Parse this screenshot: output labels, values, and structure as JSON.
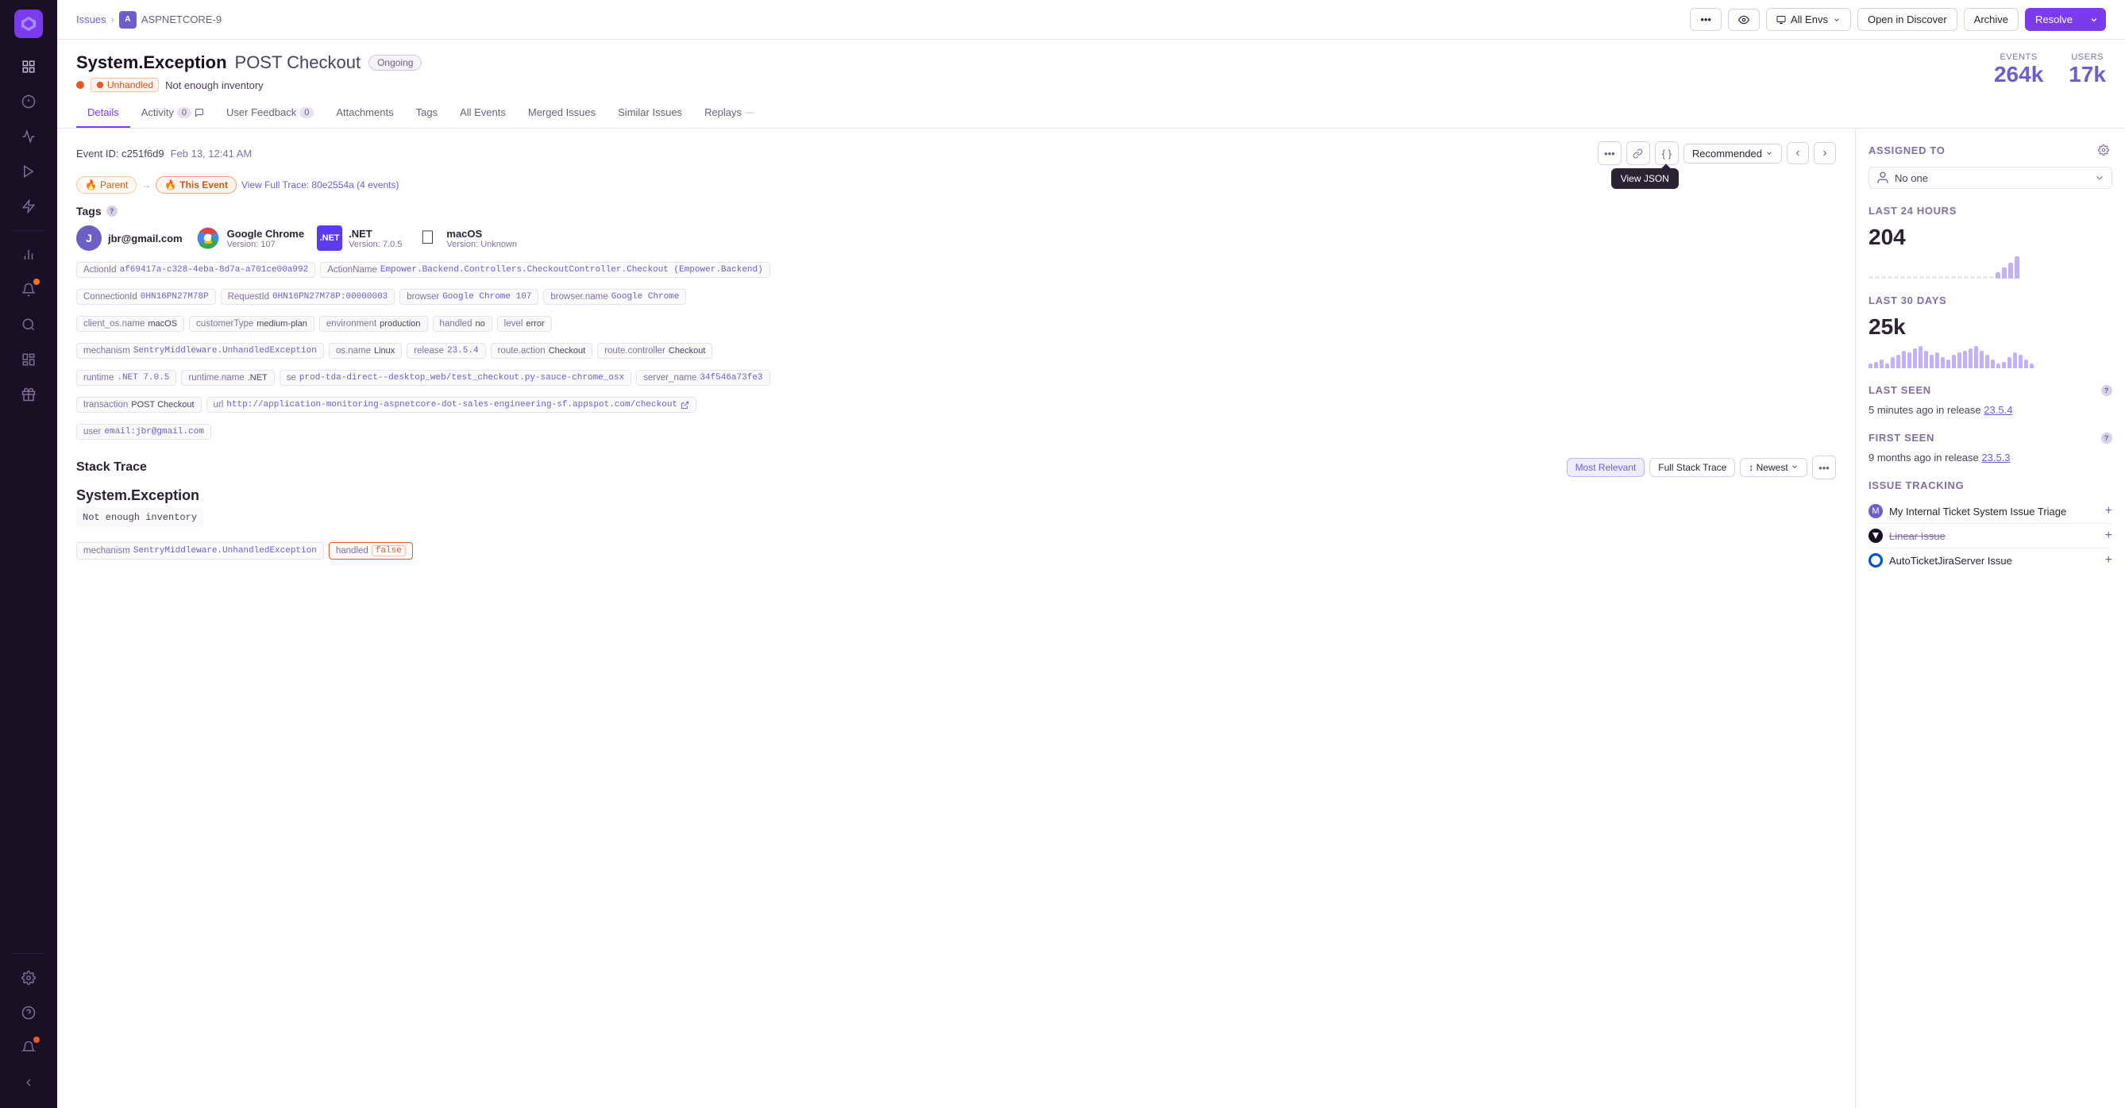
{
  "sidebar": {
    "logo": "◆",
    "items": [
      {
        "name": "issues",
        "icon": "⊡",
        "active": false
      },
      {
        "name": "performance",
        "icon": "▷",
        "active": false
      },
      {
        "name": "replays",
        "icon": "⊙",
        "active": false
      },
      {
        "name": "profiling",
        "icon": "⚡",
        "active": false
      },
      {
        "name": "metrics",
        "icon": "📈",
        "active": false
      },
      {
        "name": "alerts",
        "icon": "🔔",
        "active": false,
        "badge": true
      },
      {
        "name": "discover",
        "icon": "🔭",
        "active": false
      },
      {
        "name": "dashboards",
        "icon": "⊞",
        "active": false
      },
      {
        "name": "releases",
        "icon": "📦",
        "active": false
      },
      {
        "name": "settings",
        "icon": "⚙",
        "active": false
      }
    ],
    "bottom": [
      {
        "name": "help",
        "icon": "?"
      },
      {
        "name": "notifications",
        "icon": "🔔",
        "badge": true
      }
    ]
  },
  "breadcrumb": {
    "issues_label": "Issues",
    "project_label": "ASPNETCORE-9"
  },
  "header": {
    "more_label": "•••",
    "watch_label": "👁",
    "env_label": "All Envs",
    "open_discover_label": "Open in Discover",
    "archive_label": "Archive",
    "resolve_label": "Resolve"
  },
  "issue": {
    "title": "System.Exception",
    "subtitle": "POST Checkout",
    "status": "Ongoing",
    "unhandled_label": "Unhandled",
    "description": "Not enough inventory",
    "events_label": "EVENTS",
    "events_value": "264k",
    "users_label": "USERS",
    "users_value": "17k"
  },
  "tabs": [
    {
      "id": "details",
      "label": "Details",
      "active": true
    },
    {
      "id": "activity",
      "label": "Activity",
      "badge": "0",
      "active": false
    },
    {
      "id": "user_feedback",
      "label": "User Feedback",
      "badge": "0",
      "active": false
    },
    {
      "id": "attachments",
      "label": "Attachments",
      "active": false
    },
    {
      "id": "tags",
      "label": "Tags",
      "active": false
    },
    {
      "id": "all_events",
      "label": "All Events",
      "active": false
    },
    {
      "id": "merged_issues",
      "label": "Merged Issues",
      "active": false
    },
    {
      "id": "similar_issues",
      "label": "Similar Issues",
      "active": false
    },
    {
      "id": "replays",
      "label": "Replays",
      "active": false
    }
  ],
  "event": {
    "id": "c251f6d9",
    "time": "Feb 13, 12:41 AM",
    "nav_parent": "Parent",
    "nav_current": "This Event",
    "trace_link": "View Full Trace: 80e2554a (4 events)",
    "recommended_label": "Recommended",
    "tooltip_label": "View JSON"
  },
  "tags_section": {
    "title": "Tags",
    "browser_tags": [
      {
        "icon": "user",
        "label": "jbr@gmail.com",
        "type": "user"
      },
      {
        "icon": "chrome",
        "label": "Google Chrome",
        "sub": "Version: 107",
        "type": "chrome"
      },
      {
        "icon": "dotnet",
        "label": ".NET",
        "sub": "Version: 7.0.5",
        "type": "dotnet"
      },
      {
        "icon": "apple",
        "label": "macOS",
        "sub": "Version: Unknown",
        "type": "apple"
      }
    ],
    "tag_rows": [
      [
        {
          "key": "ActionId",
          "value": "af69417a-c328-4eba-8d7a-a701ce00a992",
          "mono": true
        },
        {
          "key": "ActionName",
          "value": "Empower.Backend.Controllers.CheckoutController.Checkout (Empower.Backend)",
          "mono": true
        }
      ],
      [
        {
          "key": "ConnectionId",
          "value": "0HN16PN27M78P",
          "mono": true
        },
        {
          "key": "RequestId",
          "value": "0HN16PN27M78P:00000003",
          "mono": true
        },
        {
          "key": "browser",
          "value": "Google Chrome 107",
          "mono": true
        },
        {
          "key": "browser.name",
          "value": "Google Chrome",
          "mono": true
        }
      ],
      [
        {
          "key": "client_os.name",
          "value": "macOS",
          "plain": true
        },
        {
          "key": "customerType",
          "value": "medium-plan",
          "plain": true
        },
        {
          "key": "environment",
          "value": "production",
          "plain": true
        },
        {
          "key": "handled",
          "value": "no",
          "plain": true
        },
        {
          "key": "level",
          "value": "error",
          "plain": true
        }
      ],
      [
        {
          "key": "mechanism",
          "value": "SentryMiddleware.UnhandledException",
          "mono": true
        },
        {
          "key": "os.name",
          "value": "Linux",
          "plain": true
        },
        {
          "key": "release",
          "value": "23.5.4",
          "mono": true
        },
        {
          "key": "route.action",
          "value": "Checkout",
          "plain": true
        },
        {
          "key": "route.controller",
          "value": "Checkout",
          "plain": true
        }
      ],
      [
        {
          "key": "runtime",
          "value": ".NET 7.0.5",
          "mono": true
        },
        {
          "key": "runtime.name",
          "value": ".NET",
          "plain": true
        },
        {
          "key": "se",
          "value": "prod-tda-direct--desktop_web/test_checkout.py-sauce-chrome_osx",
          "mono": true
        },
        {
          "key": "server_name",
          "value": "34f546a73fe3",
          "mono": true
        }
      ],
      [
        {
          "key": "transaction",
          "value": "POST Checkout",
          "plain": true
        },
        {
          "key": "url",
          "value": "http://application-monitoring-aspnetcore-dot-sales-engineering-sf.appspot.com/checkout",
          "mono": true,
          "link": true
        }
      ],
      [
        {
          "key": "user",
          "value": "email:jbr@gmail.com",
          "mono": true
        }
      ]
    ]
  },
  "stack_trace": {
    "title": "Stack Trace",
    "most_relevant_label": "Most Relevant",
    "full_stack_label": "Full Stack Trace",
    "sort_label": "Newest",
    "exception_type": "System.Exception",
    "exception_msg": "Not enough inventory",
    "mechanism_key": "mechanism",
    "mechanism_value": "SentryMiddleware.UnhandledException",
    "handled_key": "handled",
    "handled_value": "false"
  },
  "right_panel": {
    "assigned_to_label": "Assigned To",
    "assigned_value": "No one",
    "last_24h_label": "Last 24 Hours",
    "last_24h_value": "204",
    "last_30d_label": "Last 30 Days",
    "last_30d_value": "25k",
    "last_seen_label": "Last Seen",
    "last_seen_value": "5 minutes ago in release",
    "last_seen_release": "23.5.4",
    "first_seen_label": "First Seen",
    "first_seen_value": "9 months ago in release",
    "first_seen_release": "23.5.3",
    "issue_tracking_label": "Issue Tracking",
    "tracking_items": [
      {
        "label": "My Internal Ticket System Issue Triage",
        "icon": "M",
        "icon_bg": "#6c5fc7"
      },
      {
        "label": "Linear Issue",
        "icon": "L",
        "icon_bg": "#1a1025",
        "strikethrough": true
      },
      {
        "label": "AutoTicketJiraServer Issue",
        "icon": "J",
        "icon_bg": "#0052cc"
      }
    ],
    "bars_24h": [
      0,
      0,
      0,
      0,
      0,
      0,
      0,
      0,
      0,
      0,
      0,
      0,
      0,
      0,
      0,
      0,
      0,
      0,
      0,
      0,
      30,
      50,
      70,
      100
    ],
    "bars_30d": [
      20,
      30,
      40,
      20,
      50,
      60,
      80,
      70,
      90,
      100,
      80,
      60,
      70,
      50,
      40,
      60,
      70,
      80,
      90,
      100,
      80,
      60,
      40,
      20,
      30,
      50,
      70,
      60,
      40,
      20
    ]
  }
}
